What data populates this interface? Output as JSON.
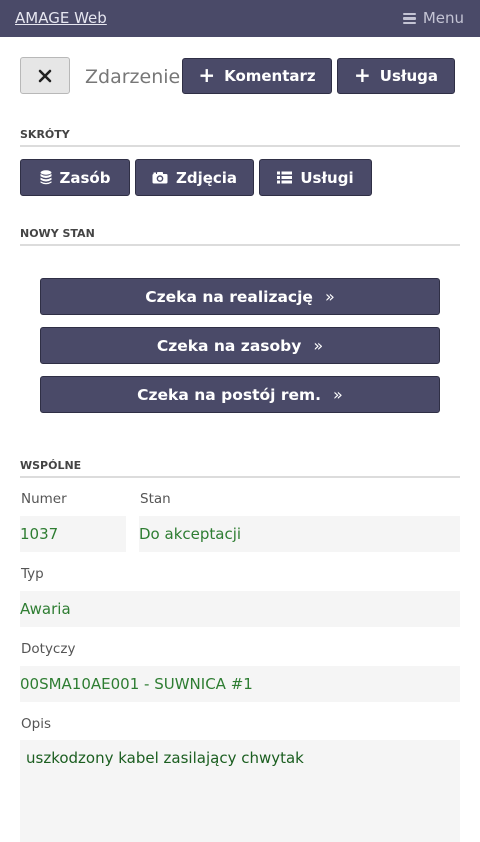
{
  "navbar": {
    "brand": "AMAGE Web",
    "menu_label": "Menu",
    "menu_icon": "hamburger-icon"
  },
  "header": {
    "title": "Zdarzenie",
    "close_icon": "close-icon",
    "comment_button": "Komentarz",
    "service_button": "Usługa"
  },
  "shortcuts": {
    "heading": "SKRÓTY",
    "items": [
      {
        "label": "Zasób",
        "icon": "database-icon"
      },
      {
        "label": "Zdjęcia",
        "icon": "camera-icon"
      },
      {
        "label": "Usługi",
        "icon": "list-icon"
      }
    ]
  },
  "new_state": {
    "heading": "NOWY STAN",
    "buttons": [
      "Czeka na realizację",
      "Czeka na zasoby",
      "Czeka na postój rem."
    ]
  },
  "common": {
    "heading": "WSPÓLNE",
    "number_label": "Numer",
    "number_value": "1037",
    "state_label": "Stan",
    "state_value": "Do akceptacji",
    "type_label": "Typ",
    "type_value": "Awaria",
    "concerns_label": "Dotyczy",
    "concerns_value": "00SMA10AE001 - SUWNICA #1",
    "description_label": "Opis",
    "description_value": "uszkodzony kabel zasilający chwytak"
  },
  "colors": {
    "primary": "#4a4a68",
    "field_text": "#2e7d32",
    "field_bg": "#f5f5f5"
  }
}
